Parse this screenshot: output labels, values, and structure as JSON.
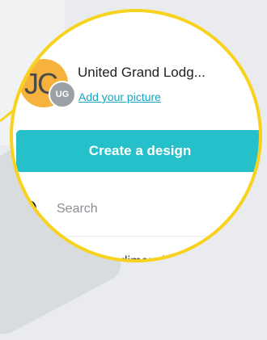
{
  "account": {
    "name": "United Grand Lodg...",
    "add_picture_label": "Add your picture",
    "avatar_initials": "JC",
    "badge_initials": "UG"
  },
  "actions": {
    "create_design_label": "Create a design"
  },
  "search": {
    "placeholder": "Search"
  },
  "menu": {
    "partial_item_label": "om dimensio"
  },
  "colors": {
    "accent": "#25c0c9",
    "link": "#1aa3c2",
    "highlight_ring": "#f7d21e",
    "avatar": "#f6b23c"
  },
  "icons": [
    "chevron-down-icon",
    "search-icon"
  ]
}
